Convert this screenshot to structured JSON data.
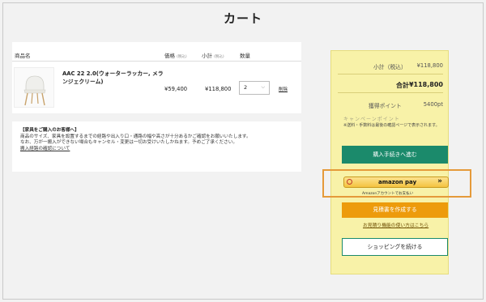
{
  "page": {
    "title": "カート"
  },
  "cart": {
    "headers": {
      "product": "商品名",
      "price": "価格",
      "price_tax": "(税込)",
      "subtotal": "小計",
      "subtotal_tax": "(税込)",
      "quantity": "数量"
    },
    "item": {
      "name": "AAC 22 2.0(ウォーターラッカー, メランジェクリーム)",
      "price": "¥59,400",
      "subtotal": "¥118,800",
      "quantity": "2",
      "delete_label": "削除"
    }
  },
  "notice": {
    "title": "【家具をご購入のお客様へ】",
    "line1": "商品のサイズ、家具を設置するまでの経路や出入り口・通路の幅や高さが十分あるかご確認をお願いいたします。",
    "line2": "なお、万が一搬入ができない場合もキャンセル・変更は一切お受けいたしかねます。予めご了承ください。",
    "link": "搬入経路の確認について"
  },
  "summary": {
    "subtotal_label": "小計（税込）",
    "subtotal_value": "¥118,800",
    "total_label": "合計",
    "total_value": "¥118,800",
    "points_label": "獲得ポイント",
    "points_value": "5400pt",
    "cut_text": "キャンペーンポイント",
    "note": "※送料・手数料は最後の確認ページで表示されます。",
    "checkout_button": "購入手続きへ進む",
    "amazon_pay_label": "amazon pay",
    "amazon_pay_sub": "Amazonアカウントでお支払い",
    "quote_button": "見積書を作成する",
    "quote_help": "お見積り機能の使い方はこちら",
    "continue_button": "ショッピングを続ける"
  }
}
